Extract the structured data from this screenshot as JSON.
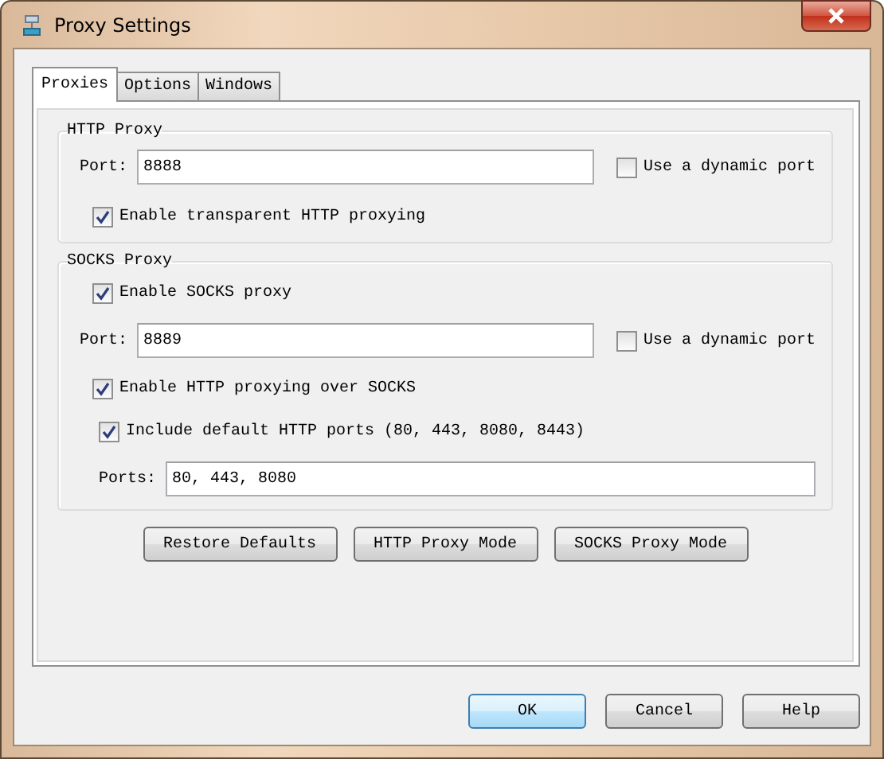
{
  "window": {
    "title": "Proxy Settings"
  },
  "tabs": [
    {
      "label": "Proxies",
      "selected": true
    },
    {
      "label": "Options",
      "selected": false
    },
    {
      "label": "Windows",
      "selected": false
    }
  ],
  "http_proxy": {
    "title": "HTTP Proxy",
    "port": {
      "label": "Port:",
      "value": "8888"
    },
    "dynamic_port": {
      "label": "Use a dynamic port",
      "checked": false
    },
    "transparent": {
      "label": "Enable transparent HTTP proxying",
      "checked": true
    }
  },
  "socks_proxy": {
    "title": "SOCKS Proxy",
    "enable": {
      "label": "Enable SOCKS proxy",
      "checked": true
    },
    "port": {
      "label": "Port:",
      "value": "8889"
    },
    "dynamic_port": {
      "label": "Use a dynamic port",
      "checked": false
    },
    "http_over_socks": {
      "label": "Enable HTTP proxying over SOCKS",
      "checked": true
    },
    "include_default_ports": {
      "label": "Include default HTTP ports (80, 443, 8080, 8443)",
      "checked": true
    },
    "ports": {
      "label": "Ports:",
      "value": "80, 443, 8080"
    }
  },
  "panel_buttons": [
    "Restore Defaults",
    "HTTP Proxy Mode",
    "SOCKS Proxy Mode"
  ],
  "dialog_buttons": [
    {
      "label": "OK",
      "default": true
    },
    {
      "label": "Cancel",
      "default": false
    },
    {
      "label": "Help",
      "default": false
    }
  ]
}
